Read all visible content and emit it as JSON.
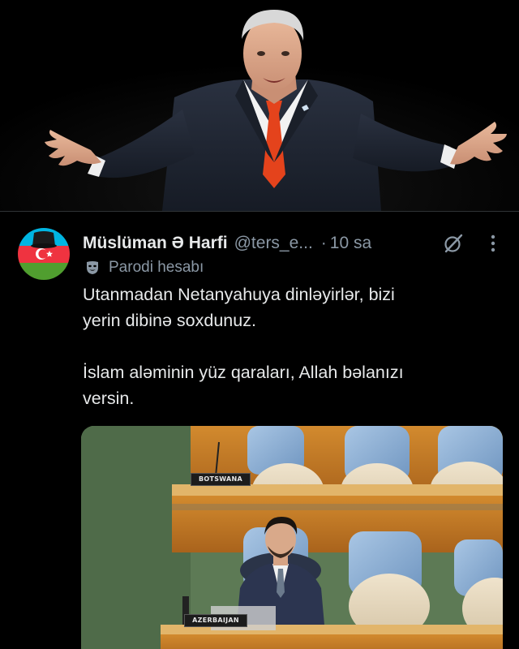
{
  "tweet": {
    "display_name": "Müslüman Ə Harfi",
    "handle": "@ters_e...",
    "separator": "·",
    "timestamp": "10 sa",
    "parody_label": "Parodi hesabı",
    "text_line_1": "Utanmadan Netanyahuya dinləyirlər, bizi",
    "text_line_2": "yerin dibinə soxdunuz.",
    "text_line_3": "İslam aləminin yüz qaraları, Allah bəlanızı",
    "text_line_4": "versin."
  },
  "media": {
    "nameplate_1": "BOTSWANA",
    "nameplate_2": "AZERBAIJAN"
  },
  "icons": {
    "grok": "grok-icon",
    "more": "more-options-icon",
    "parody": "theater-mask-icon"
  },
  "colors": {
    "background": "#000000",
    "text_primary": "#e7e9ea",
    "text_secondary": "#8b98a5",
    "flag_blue": "#00b5e2",
    "flag_red": "#ef3340",
    "flag_green": "#509e2f"
  }
}
